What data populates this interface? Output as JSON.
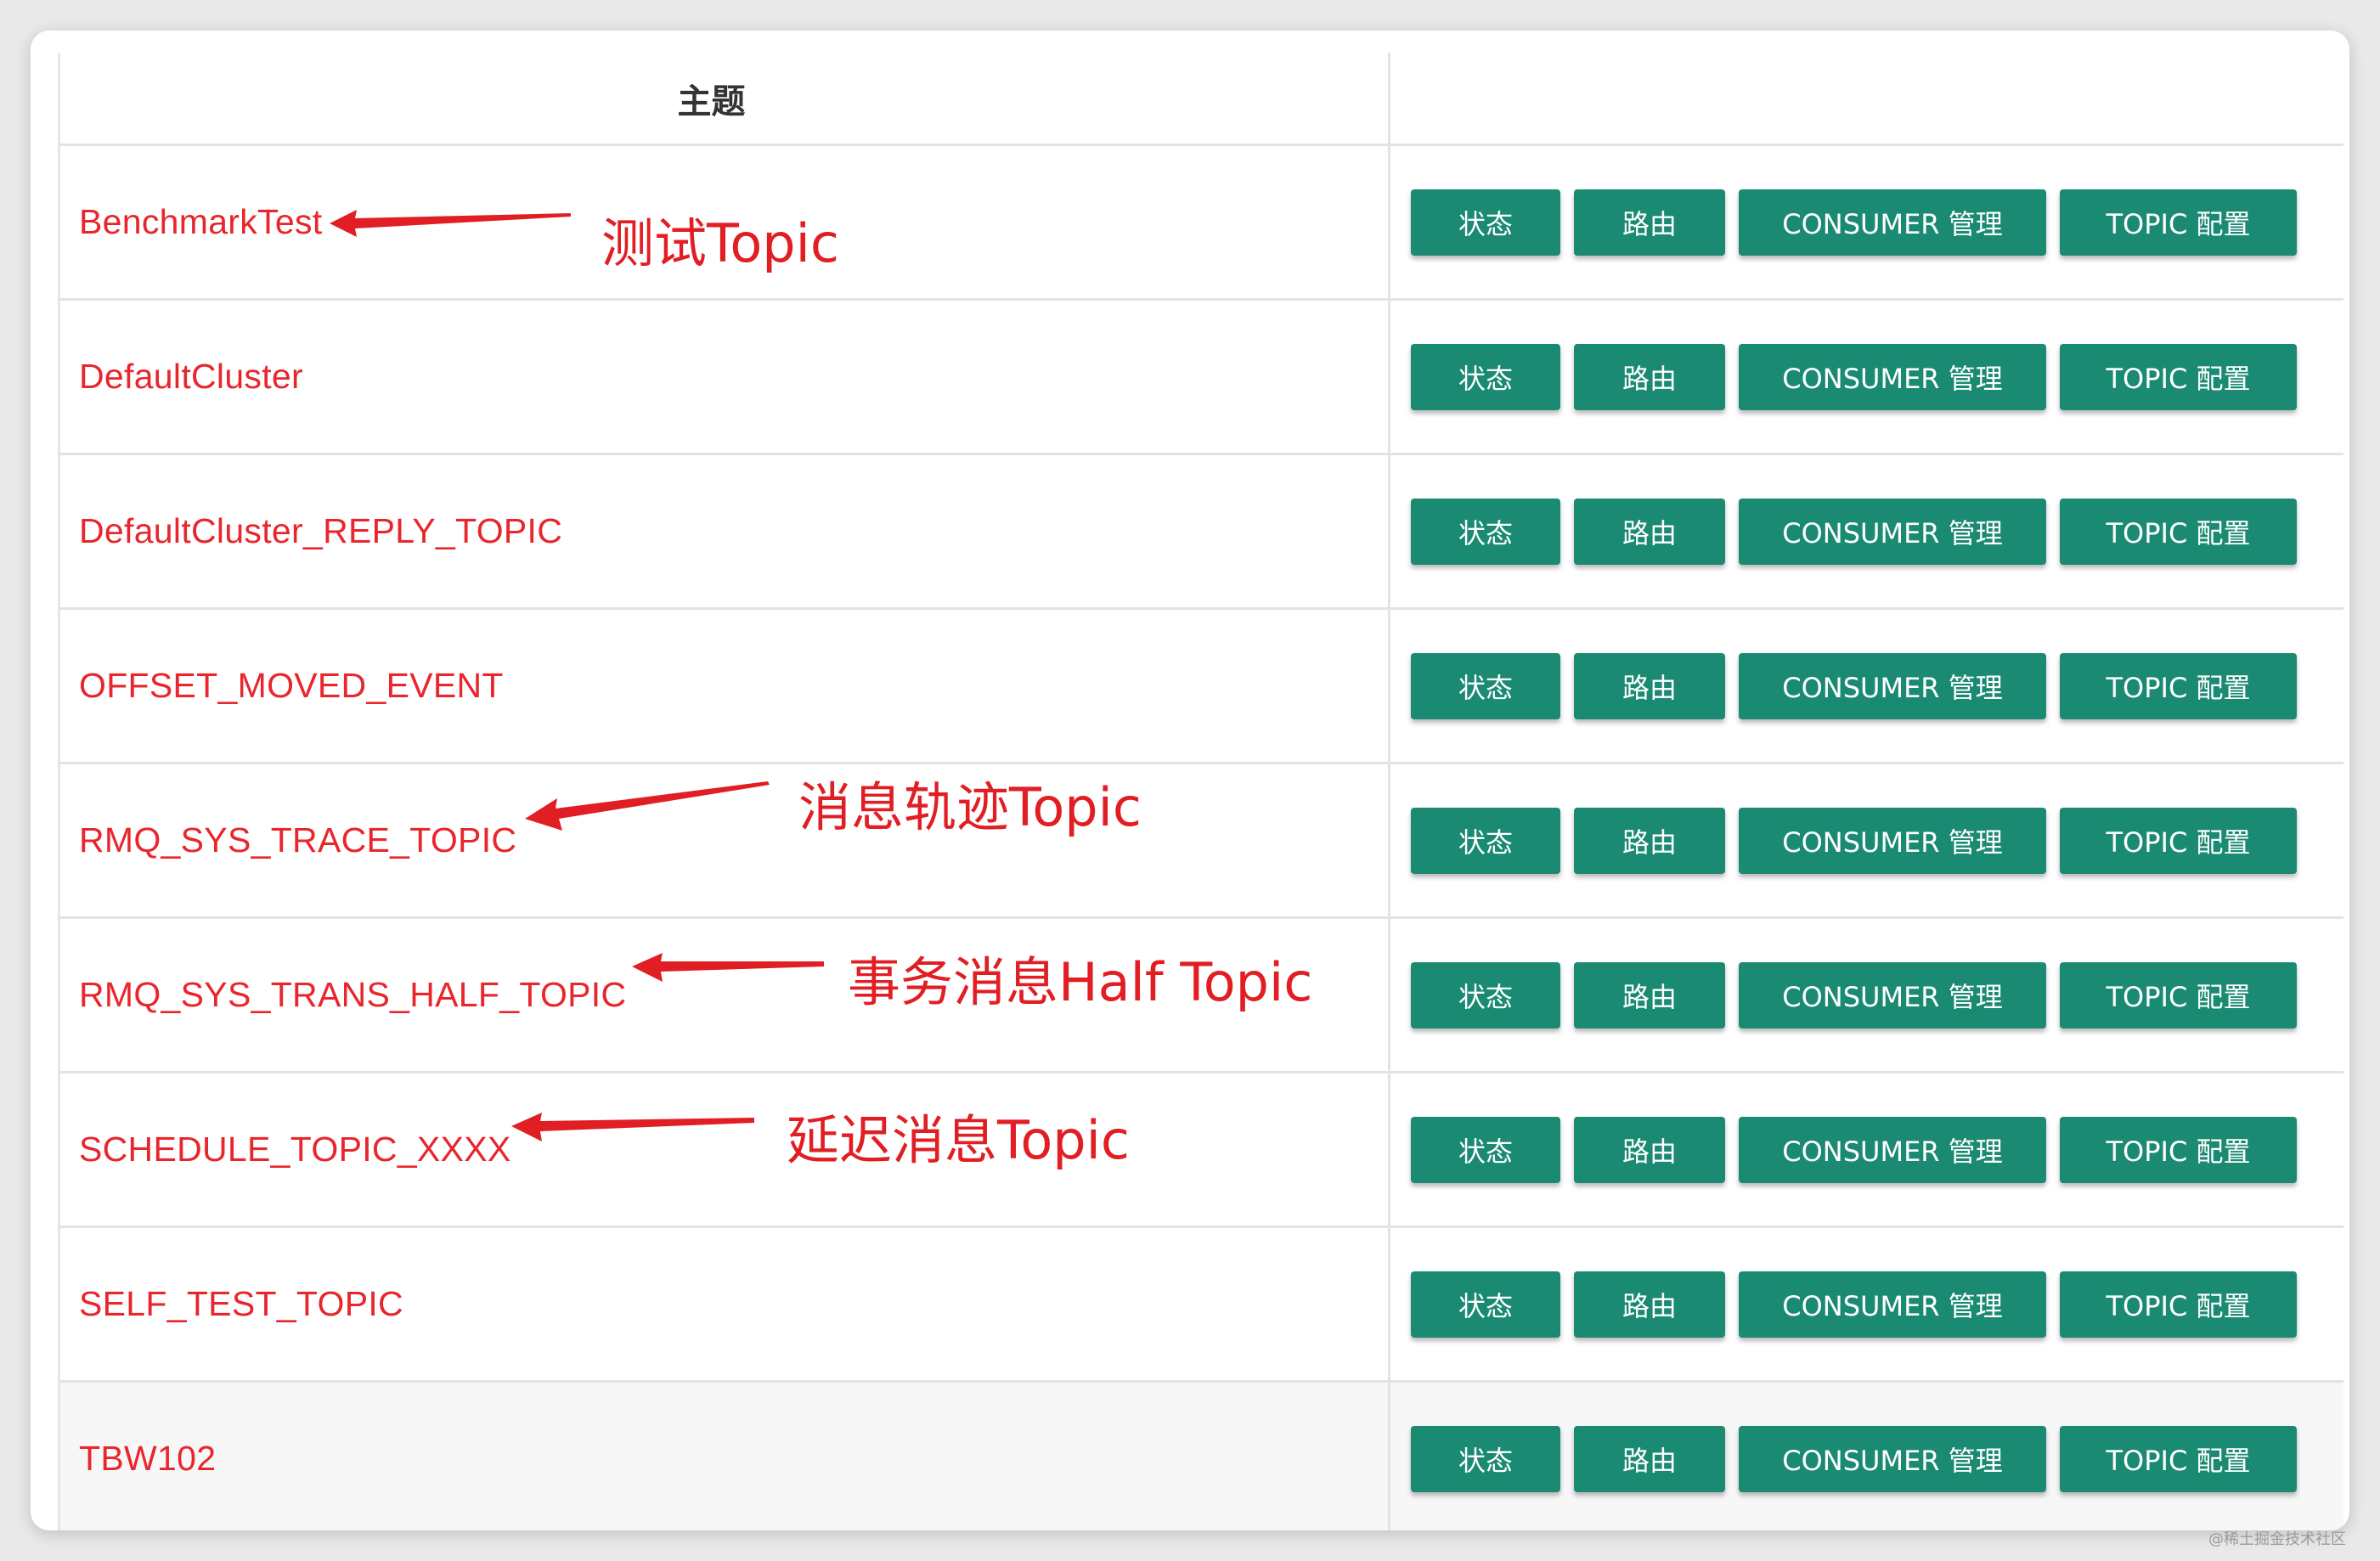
{
  "table": {
    "header_topic": "主题",
    "rows": [
      {
        "name": "BenchmarkTest"
      },
      {
        "name": "DefaultCluster"
      },
      {
        "name": "DefaultCluster_REPLY_TOPIC"
      },
      {
        "name": "OFFSET_MOVED_EVENT"
      },
      {
        "name": "RMQ_SYS_TRACE_TOPIC"
      },
      {
        "name": "RMQ_SYS_TRANS_HALF_TOPIC"
      },
      {
        "name": "SCHEDULE_TOPIC_XXXX"
      },
      {
        "name": "SELF_TEST_TOPIC"
      },
      {
        "name": "TBW102"
      }
    ],
    "buttons": {
      "status": "状态",
      "route": "路由",
      "consumer": "CONSUMER 管理",
      "config": "TOPIC 配置"
    }
  },
  "annotations": {
    "benchmark": "测试Topic",
    "trace": "消息轨迹Topic",
    "trans_half": "事务消息Half Topic",
    "schedule": "延迟消息Topic"
  },
  "watermark": "@稀土掘金技术社区",
  "colors": {
    "button": "#1a8a72",
    "topic_text": "#e8262c",
    "annotation": "#e11e23"
  }
}
